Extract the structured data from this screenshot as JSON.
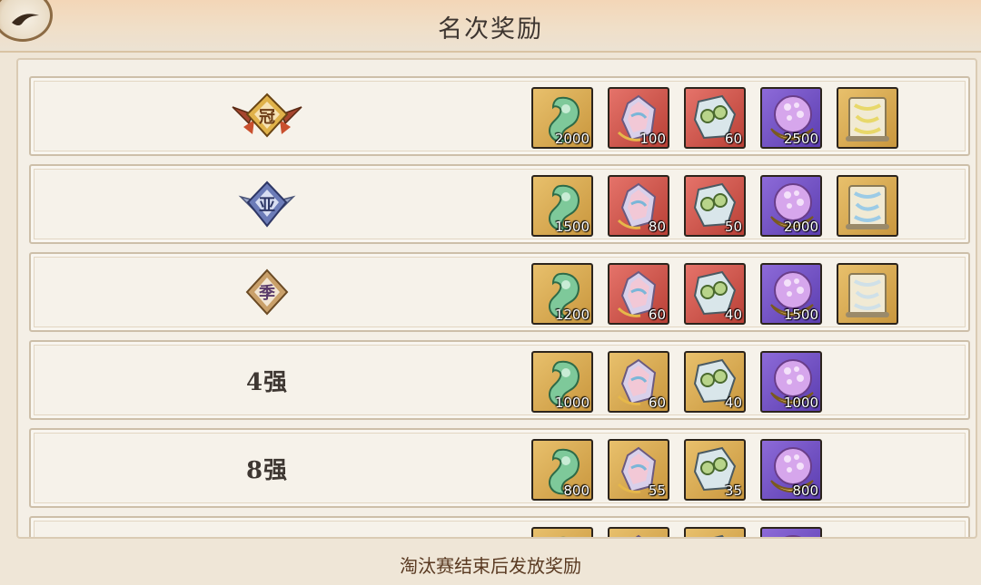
{
  "header": {
    "title": "名次奖励"
  },
  "footer": {
    "note": "淘汰赛结束后发放奖励"
  },
  "rows": [
    {
      "rank_type": "badge",
      "badge_char": "冠",
      "badge": "gold-crown-badge",
      "items": [
        {
          "icon": "jade-magatama-icon",
          "bg": "gold",
          "qty": "2000"
        },
        {
          "icon": "rainbow-crystal-icon",
          "bg": "red",
          "qty": "100"
        },
        {
          "icon": "shield-orb-icon",
          "bg": "red",
          "qty": "60"
        },
        {
          "icon": "purple-orb-icon",
          "bg": "purple",
          "qty": "2500"
        },
        {
          "icon": "gold-scroll-icon",
          "bg": "gold",
          "qty": ""
        }
      ]
    },
    {
      "rank_type": "badge",
      "badge_char": "亚",
      "badge": "silver-runnerup-badge",
      "items": [
        {
          "icon": "jade-magatama-icon",
          "bg": "gold",
          "qty": "1500"
        },
        {
          "icon": "rainbow-crystal-icon",
          "bg": "red",
          "qty": "80"
        },
        {
          "icon": "shield-orb-icon",
          "bg": "red",
          "qty": "50"
        },
        {
          "icon": "purple-orb-icon",
          "bg": "purple",
          "qty": "2000"
        },
        {
          "icon": "blue-scroll-icon",
          "bg": "gold",
          "qty": ""
        }
      ]
    },
    {
      "rank_type": "badge",
      "badge_char": "季",
      "badge": "bronze-third-badge",
      "items": [
        {
          "icon": "jade-magatama-icon",
          "bg": "gold",
          "qty": "1200"
        },
        {
          "icon": "rainbow-crystal-icon",
          "bg": "red",
          "qty": "60"
        },
        {
          "icon": "shield-orb-icon",
          "bg": "red",
          "qty": "40"
        },
        {
          "icon": "purple-orb-icon",
          "bg": "purple",
          "qty": "1500"
        },
        {
          "icon": "white-scroll-icon",
          "bg": "gold",
          "qty": ""
        }
      ]
    },
    {
      "rank_type": "text",
      "label": "4强",
      "items": [
        {
          "icon": "jade-magatama-icon",
          "bg": "gold",
          "qty": "1000"
        },
        {
          "icon": "rainbow-crystal-icon",
          "bg": "gold",
          "qty": "60"
        },
        {
          "icon": "shield-orb-icon",
          "bg": "gold",
          "qty": "40"
        },
        {
          "icon": "purple-orb-icon",
          "bg": "purple",
          "qty": "1000"
        }
      ]
    },
    {
      "rank_type": "text",
      "label": "8强",
      "items": [
        {
          "icon": "jade-magatama-icon",
          "bg": "gold",
          "qty": "800"
        },
        {
          "icon": "rainbow-crystal-icon",
          "bg": "gold",
          "qty": "55"
        },
        {
          "icon": "shield-orb-icon",
          "bg": "gold",
          "qty": "35"
        },
        {
          "icon": "purple-orb-icon",
          "bg": "purple",
          "qty": "800"
        }
      ]
    },
    {
      "rank_type": "text",
      "label": "",
      "items": [
        {
          "icon": "jade-magatama-icon",
          "bg": "gold",
          "qty": ""
        },
        {
          "icon": "rainbow-crystal-icon",
          "bg": "gold",
          "qty": ""
        },
        {
          "icon": "shield-orb-icon",
          "bg": "gold",
          "qty": ""
        },
        {
          "icon": "purple-orb-icon",
          "bg": "purple",
          "qty": ""
        }
      ]
    }
  ]
}
